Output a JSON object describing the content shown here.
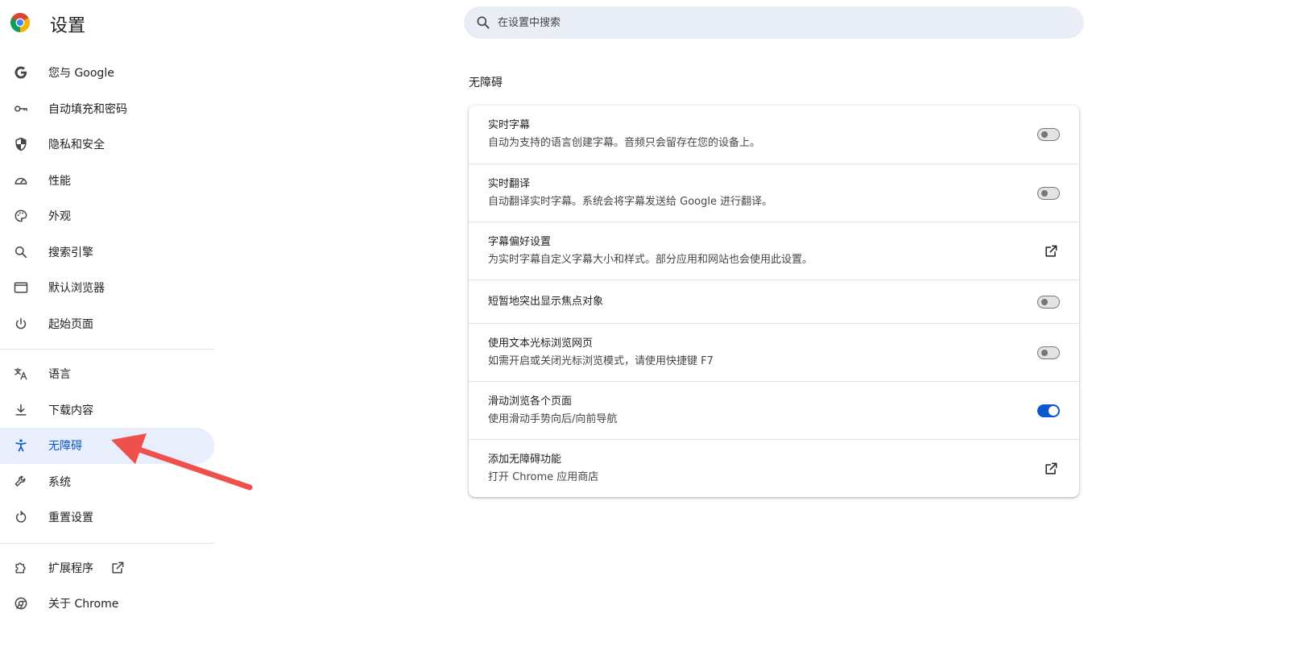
{
  "header": {
    "title": "设置",
    "logo_icon": "chrome-logo-icon"
  },
  "search": {
    "placeholder": "在设置中搜索",
    "value": ""
  },
  "sidebar": {
    "items": [
      {
        "label": "您与 Google",
        "icon": "google-g-icon"
      },
      {
        "label": "自动填充和密码",
        "icon": "key-icon"
      },
      {
        "label": "隐私和安全",
        "icon": "shield-icon"
      },
      {
        "label": "性能",
        "icon": "speedometer-icon"
      },
      {
        "label": "外观",
        "icon": "palette-icon"
      },
      {
        "label": "搜索引擎",
        "icon": "search-icon"
      },
      {
        "label": "默认浏览器",
        "icon": "browser-window-icon"
      },
      {
        "label": "起始页面",
        "icon": "power-icon"
      },
      {
        "label": "语言",
        "icon": "translate-icon"
      },
      {
        "label": "下载内容",
        "icon": "download-icon"
      },
      {
        "label": "无障碍",
        "icon": "accessibility-icon",
        "active": true
      },
      {
        "label": "系统",
        "icon": "wrench-icon"
      },
      {
        "label": "重置设置",
        "icon": "reset-icon"
      },
      {
        "label": "扩展程序",
        "icon": "puzzle-icon"
      },
      {
        "label": "关于 Chrome",
        "icon": "chrome-outline-icon"
      }
    ]
  },
  "main": {
    "section_title": "无障碍",
    "rows": [
      {
        "title": "实时字幕",
        "subtitle": "自动为支持的语言创建字幕。音频只会留存在您的设备上。",
        "control": "toggle",
        "on": false
      },
      {
        "title": "实时翻译",
        "subtitle": "自动翻译实时字幕。系统会将字幕发送给 Google 进行翻译。",
        "control": "toggle",
        "on": false
      },
      {
        "title": "字幕偏好设置",
        "subtitle": "为实时字幕自定义字幕大小和样式。部分应用和网站也会使用此设置。",
        "control": "external-link"
      },
      {
        "title": "短暂地突出显示焦点对象",
        "subtitle": "",
        "control": "toggle",
        "on": false
      },
      {
        "title": "使用文本光标浏览网页",
        "subtitle": "如需开启或关闭光标浏览模式，请使用快捷键 F7",
        "control": "toggle",
        "on": false
      },
      {
        "title": "滑动浏览各个页面",
        "subtitle": "使用滑动手势向后/向前导航",
        "control": "toggle",
        "on": true
      },
      {
        "title": "添加无障碍功能",
        "subtitle": "打开 Chrome 应用商店",
        "control": "external-link"
      }
    ]
  },
  "colors": {
    "accent": "#0b57d0",
    "active_bg": "#e8eefc",
    "search_bg": "#e9eef6",
    "annotation_arrow": "#f0504b"
  }
}
